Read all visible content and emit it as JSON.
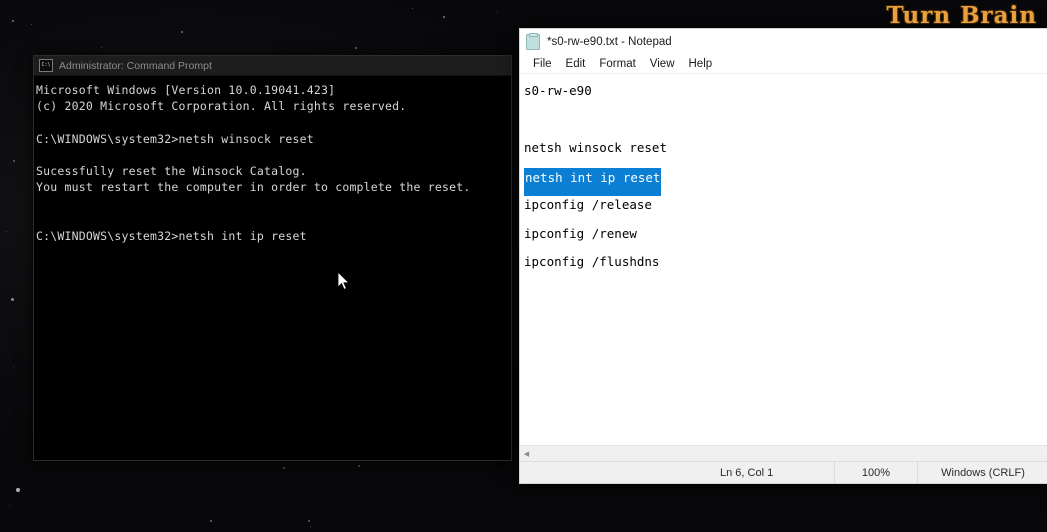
{
  "desktop": {
    "watermark": "Turn Brain",
    "watermark_color": "#e8a13c",
    "background_color": "#08080a"
  },
  "cmd_window": {
    "icon": "command-prompt-icon",
    "icon_glyph": "C:\\",
    "title": "Administrator: Command Prompt",
    "title_color": "#8d8d8d",
    "background_color": "#000000",
    "text_color": "#d6d6d6",
    "lines": [
      "Microsoft Windows [Version 10.0.19041.423]",
      "(c) 2020 Microsoft Corporation. All rights reserved.",
      "",
      "C:\\WINDOWS\\system32>netsh winsock reset",
      "",
      "Sucessfully reset the Winsock Catalog.",
      "You must restart the computer in order to complete the reset.",
      "",
      "",
      "C:\\WINDOWS\\system32>netsh int ip reset"
    ]
  },
  "notepad_window": {
    "icon": "notepad-icon",
    "title": "*s0-rw-e90.txt - Notepad",
    "menu": [
      {
        "label": "File"
      },
      {
        "label": "Edit"
      },
      {
        "label": "Format"
      },
      {
        "label": "View"
      },
      {
        "label": "Help"
      }
    ],
    "selection_color": "#0b7fd4",
    "document_lines": [
      {
        "text": "s0-rw-e90",
        "selected": false
      },
      {
        "text": "",
        "selected": false
      },
      {
        "text": "netsh winsock reset",
        "selected": false
      },
      {
        "text": "netsh int ip reset",
        "selected": true
      },
      {
        "text": "ipconfig /release",
        "selected": false
      },
      {
        "text": "ipconfig /renew",
        "selected": false
      },
      {
        "text": "ipconfig /flushdns",
        "selected": false
      }
    ],
    "hscrollbar": {
      "left_arrow": "chevron-left-icon"
    },
    "statusbar": {
      "position": "Ln 6, Col 1",
      "zoom": "100%",
      "line_ending": "Windows (CRLF)"
    }
  }
}
